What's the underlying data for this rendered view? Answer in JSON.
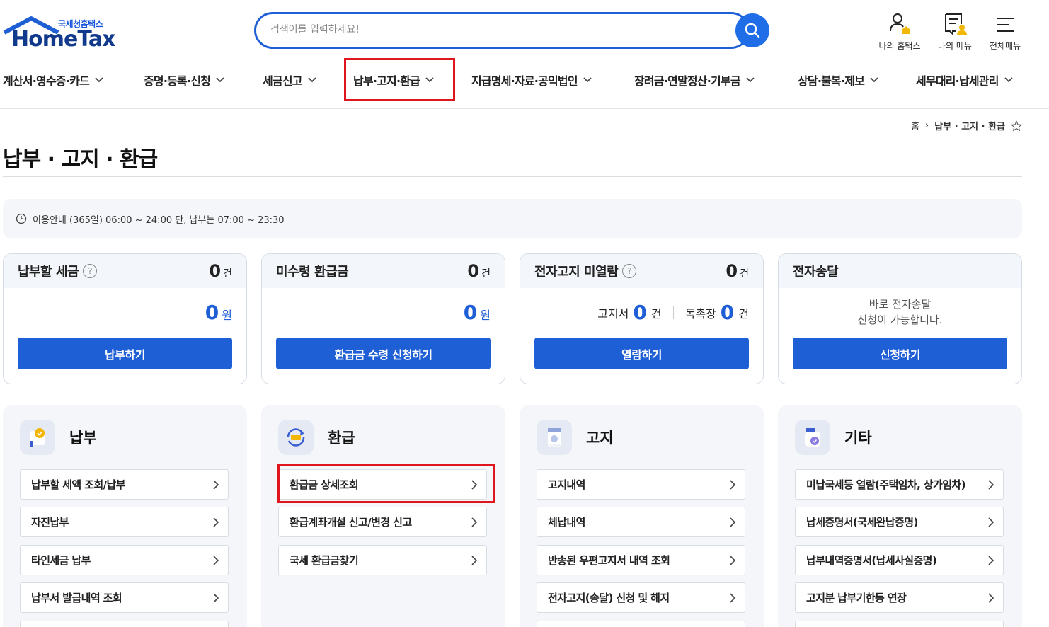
{
  "header": {
    "logo_sub": "국세청홈택스",
    "logo_main": "HomeTax",
    "search_placeholder": "검색어를 입력하세요!",
    "util": [
      {
        "label": "나의 홈택스",
        "icon": "user-home-icon"
      },
      {
        "label": "나의 메뉴",
        "icon": "my-menu-icon"
      },
      {
        "label": "전체메뉴",
        "icon": "hamburger-icon"
      }
    ]
  },
  "gnb": [
    "계산서·영수증·카드",
    "증명·등록·신청",
    "세금신고",
    "납부·고지·환급",
    "지급명세·자료·공익법인",
    "장려금·연말정산·기부금",
    "상담·불복·제보",
    "세무대리·납세관리"
  ],
  "breadcrumb": {
    "home": "홈",
    "current": "납부 · 고지 · 환급"
  },
  "page_title": "납부 · 고지 · 환급",
  "notice": "이용안내 (365일) 06:00 ~ 24:00 단, 납부는 07:00 ~ 23:30",
  "cards": {
    "pay": {
      "title": "납부할 세금",
      "count": "0",
      "count_unit": "건",
      "amount": "0",
      "amount_unit": "원",
      "button": "납부하기"
    },
    "refund": {
      "title": "미수령 환급금",
      "count": "0",
      "count_unit": "건",
      "amount": "0",
      "amount_unit": "원",
      "button": "환급금 수령 신청하기"
    },
    "notice": {
      "title": "전자고지 미열람",
      "count": "0",
      "count_unit": "건",
      "bill_label": "고지서",
      "bill_count": "0",
      "bill_unit": "건",
      "urge_label": "독촉장",
      "urge_count": "0",
      "urge_unit": "건",
      "button": "열람하기"
    },
    "edelivery": {
      "title": "전자송달",
      "msg1": "바로 전자송달",
      "msg2": "신청이 가능합니다.",
      "button": "신청하기"
    }
  },
  "panels": {
    "pay": {
      "title": "납부",
      "links": [
        "납부할 세액 조회/납부",
        "자진납부",
        "타인세금 납부",
        "납부서 발급내역 조회"
      ]
    },
    "refund": {
      "title": "환급",
      "links": [
        "환급금 상세조회",
        "환급계좌개설 신고/변경 신고",
        "국세 환급금찾기"
      ]
    },
    "notice": {
      "title": "고지",
      "links": [
        "고지내역",
        "체납내역",
        "반송된 우편고지서 내역 조회",
        "전자고지(송달) 신청 및 해지"
      ]
    },
    "etc": {
      "title": "기타",
      "links": [
        "미납국세등 열람(주택임차, 상가임차)",
        "납세증명서(국세완납증명)",
        "납부내역증명서(납세사실증명)",
        "고지분 납부기한등 연장"
      ]
    }
  },
  "colors": {
    "primary": "#1f5fd6",
    "highlight": "#e0161e",
    "logo": "#123a8c"
  }
}
